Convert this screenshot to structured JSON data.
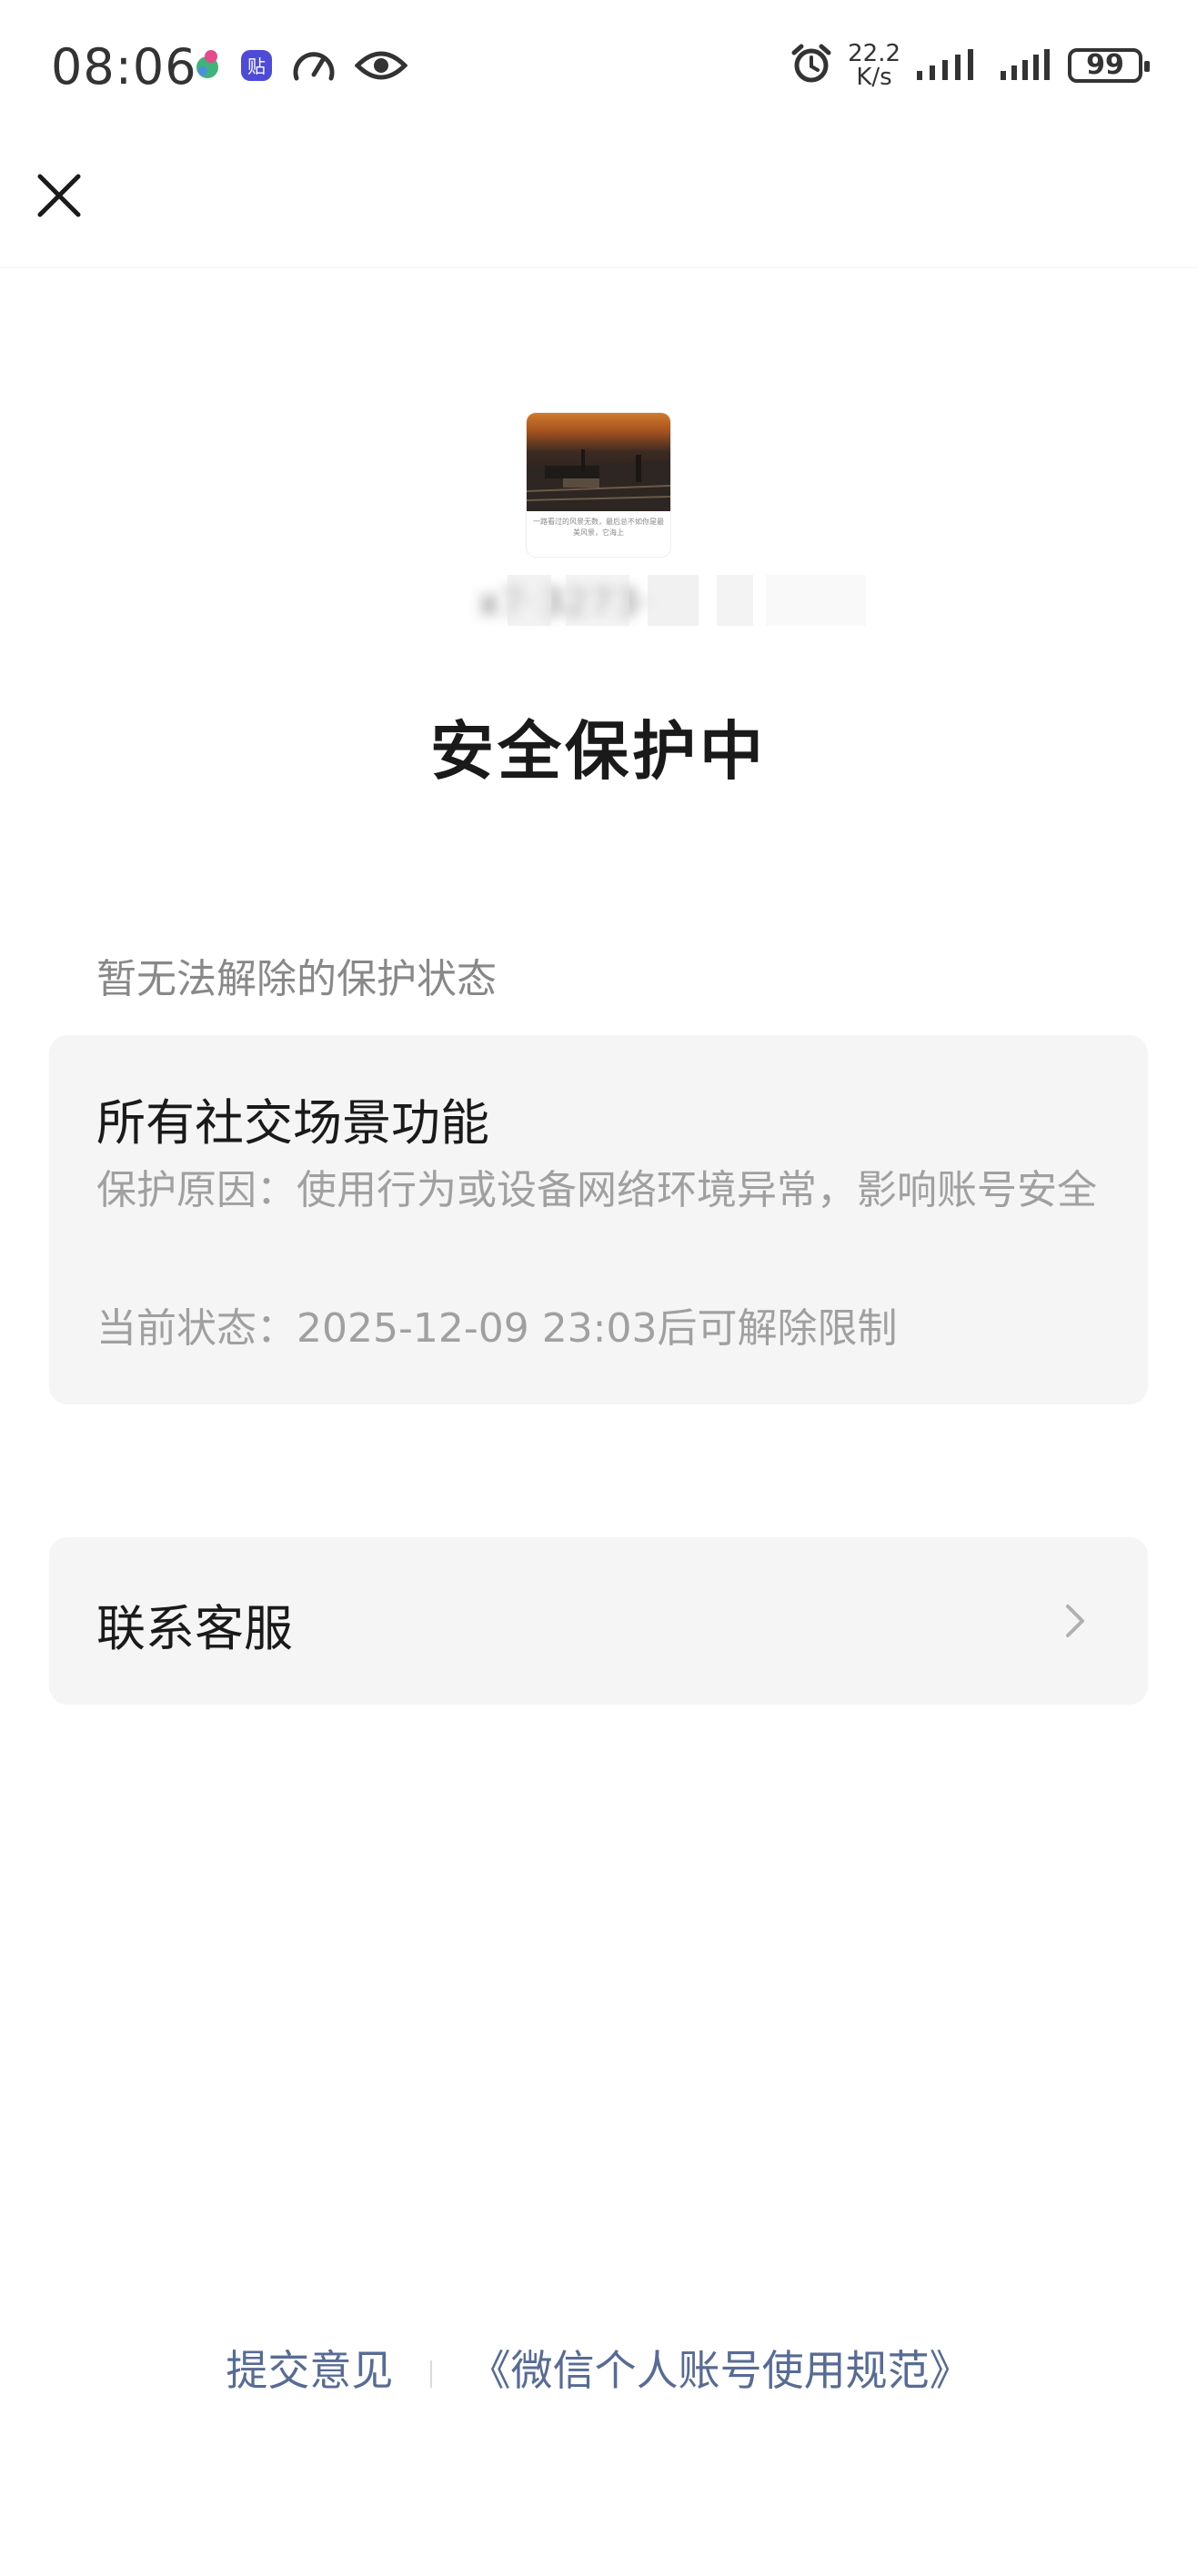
{
  "status_bar": {
    "time": "08:06",
    "net_speed_value": "22.2",
    "net_speed_unit": "K/s",
    "battery": "99",
    "left_icons": [
      "app-notification-icon",
      "tieba-icon",
      "speedometer-icon",
      "eye-icon"
    ],
    "right_icons": [
      "alarm-icon",
      "signal-1-icon",
      "signal-2-icon",
      "battery-icon"
    ]
  },
  "header": {
    "close_icon": "close-icon"
  },
  "profile": {
    "avatar_caption": "一路看过的风景无数，最后总不如你是最美风景，它海上",
    "account_name": "x7·3273·",
    "account_redacted": true
  },
  "page_title": "安全保护中",
  "section_label": "暂无法解除的保护状态",
  "restriction_card": {
    "title": "所有社交场景功能",
    "reason": "保护原因：使用行为或设备网络环境异常，影响账号安全",
    "status": "当前状态：2025-12-09 23:03后可解除限制"
  },
  "contact_row": {
    "label": "联系客服",
    "chevron_icon": "chevron-right-icon"
  },
  "footer": {
    "feedback_link": "提交意见",
    "rules_link": "《微信个人账号使用规范》"
  },
  "colors": {
    "link": "#576b95",
    "card_bg": "#f5f5f5",
    "secondary_text": "#a0a0a0"
  }
}
